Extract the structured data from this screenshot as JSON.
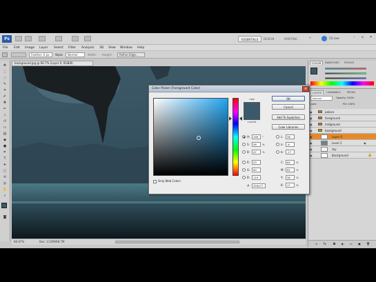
{
  "app": {
    "logo": "Ps",
    "workspaces": [
      "ESSENTIALS",
      "DESIGN",
      "PAINTING"
    ],
    "active_workspace": "ESSENTIALS",
    "cs_live_label": "CS Live"
  },
  "menu": [
    "File",
    "Edit",
    "Image",
    "Layer",
    "Select",
    "Filter",
    "Analysis",
    "3D",
    "View",
    "Window",
    "Help"
  ],
  "options": {
    "feather_label": "Feather: 0 px",
    "style_label": "Style:",
    "style_value": "Normal",
    "width_label": "Width:",
    "height_label": "Height:",
    "refine_label": "Refine Edge..."
  },
  "document": {
    "tab_title": "background.jpg @ 66.7% (Layer 0, RGB/8)",
    "zoom": "66.67%",
    "doc_info": "Doc: 3.52M/68.7M"
  },
  "panels": {
    "color_tabs": [
      "COLOR",
      "SWATCHES",
      "STYLES"
    ],
    "adjust_tabs": [
      "LAYERS",
      "CHANNELS",
      "PATHS"
    ],
    "blend_mode": "Normal",
    "opacity_label": "Opacity: 100%",
    "fill_label": "Fill: 100%",
    "lock_label": "Lock:",
    "layers": [
      {
        "name": "palace",
        "type": "folder"
      },
      {
        "name": "foreground",
        "type": "folder"
      },
      {
        "name": "midground",
        "type": "folder"
      },
      {
        "name": "background",
        "type": "folder"
      },
      {
        "name": "Layer 0",
        "type": "layer",
        "selected": true
      },
      {
        "name": "Level 1",
        "type": "layer"
      },
      {
        "name": "sky",
        "type": "layer"
      },
      {
        "name": "Background",
        "type": "layer"
      }
    ]
  },
  "dialog": {
    "title": "Color Picker (Foreground Color)",
    "label_new": "new",
    "label_current": "current",
    "buttons": {
      "ok": "OK",
      "cancel": "Cancel",
      "add_swatches": "Add To Swatches",
      "color_libraries": "Color Libraries"
    },
    "fields_left": [
      {
        "label": "H:",
        "value": "199",
        "unit": "°",
        "checked": true
      },
      {
        "label": "S:",
        "value": "56",
        "unit": "%",
        "checked": false
      },
      {
        "label": "B:",
        "value": "47",
        "unit": "%",
        "checked": false
      },
      {
        "label": "R:",
        "value": "53",
        "unit": "",
        "checked": false
      },
      {
        "label": "G:",
        "value": "90",
        "unit": "",
        "checked": false
      },
      {
        "label": "B:",
        "value": "119",
        "unit": "",
        "checked": false
      }
    ],
    "fields_right": [
      {
        "label": "L:",
        "value": "36",
        "unit": ""
      },
      {
        "label": "a:",
        "value": "-6",
        "unit": ""
      },
      {
        "label": "b:",
        "value": "-17",
        "unit": ""
      },
      {
        "label": "C:",
        "value": "85",
        "unit": "%"
      },
      {
        "label": "M:",
        "value": "62",
        "unit": "%"
      },
      {
        "label": "Y:",
        "value": "38",
        "unit": "%"
      },
      {
        "label": "K:",
        "value": "17",
        "unit": "%"
      }
    ],
    "hex_label": "#",
    "hex_value": "355a77",
    "only_web_colors": "Only Web Colors"
  },
  "colors": {
    "selected_color": "#3a5a6b",
    "layer_selected": "#e58a2b"
  }
}
